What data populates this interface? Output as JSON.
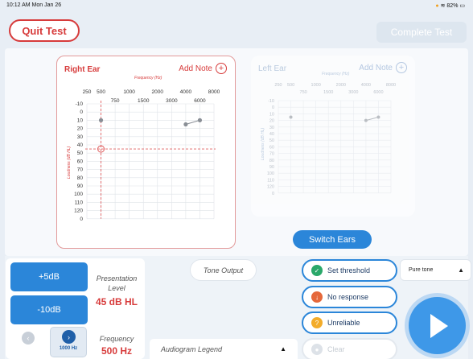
{
  "status": {
    "time": "10:12 AM  Mon Jan 26",
    "battery": "82%",
    "wifi_icon": "wifi-icon"
  },
  "header": {
    "quit_label": "Quit Test",
    "complete_label": "Complete Test"
  },
  "right_ear": {
    "title": "Right Ear",
    "add_note": "Add Note",
    "freq_label": "Frequency (Hz)",
    "loud_label": "Loudness (dB HL)",
    "top_freqs": [
      "250",
      "500",
      "1000",
      "2000",
      "4000",
      "8000"
    ],
    "mid_freqs": [
      "750",
      "1500",
      "3000",
      "6000"
    ],
    "db_ticks": [
      "-10",
      "0",
      "10",
      "20",
      "30",
      "40",
      "50",
      "60",
      "70",
      "80",
      "90",
      "100",
      "110",
      "120",
      "0"
    ]
  },
  "left_ear": {
    "title": "Left Ear",
    "add_note": "Add Note",
    "freq_label": "Frequency (Hz)",
    "loud_label": "Loudness (dB HL)",
    "top_freqs": [
      "250",
      "500",
      "1000",
      "2000",
      "4000",
      "8000"
    ],
    "mid_freqs": [
      "750",
      "1500",
      "3000",
      "6000"
    ],
    "db_ticks": [
      "-10",
      "0",
      "10",
      "20",
      "30",
      "40",
      "50",
      "60",
      "70",
      "80",
      "90",
      "100",
      "110",
      "120",
      "0"
    ]
  },
  "chart_data": [
    {
      "type": "scatter",
      "title": "Right Ear",
      "xlabel": "Frequency (Hz)",
      "ylabel": "Loudness (dB HL)",
      "x_ticks": [
        "250",
        "500",
        "750",
        "1000",
        "1500",
        "2000",
        "3000",
        "4000",
        "6000",
        "8000"
      ],
      "ylim": [
        -10,
        120
      ],
      "points": [
        {
          "freq": "500",
          "db": 10
        },
        {
          "freq": "4000",
          "db": 15
        },
        {
          "freq": "6000",
          "db": 10
        }
      ],
      "current": {
        "freq": "500",
        "db": 45
      }
    },
    {
      "type": "scatter",
      "title": "Left Ear",
      "xlabel": "Frequency (Hz)",
      "ylabel": "Loudness (dB HL)",
      "x_ticks": [
        "250",
        "500",
        "750",
        "1000",
        "1500",
        "2000",
        "3000",
        "4000",
        "6000",
        "8000"
      ],
      "ylim": [
        -10,
        120
      ],
      "points": [
        {
          "freq": "500",
          "db": 15
        },
        {
          "freq": "4000",
          "db": 20
        },
        {
          "freq": "6000",
          "db": 15
        }
      ]
    }
  ],
  "switch_ears": "Switch Ears",
  "controls": {
    "plus_label": "+5dB",
    "minus_label": "-10dB",
    "presentation_label": "Presentation Level",
    "presentation_value": "45 dB HL",
    "freq_chip": "1000 Hz",
    "frequency_label": "Frequency",
    "frequency_value": "500 Hz",
    "tone_output": "Tone Output",
    "legend": "Audiogram Legend",
    "tone_type": "Pure tone"
  },
  "responses": {
    "set_threshold": "Set threshold",
    "no_response": "No response",
    "unreliable": "Unreliable",
    "clear": "Clear"
  },
  "colors": {
    "accent": "#2b86d9",
    "danger": "#d73b3b",
    "check": "#2aa86a",
    "warning": "#f3ac2a"
  }
}
